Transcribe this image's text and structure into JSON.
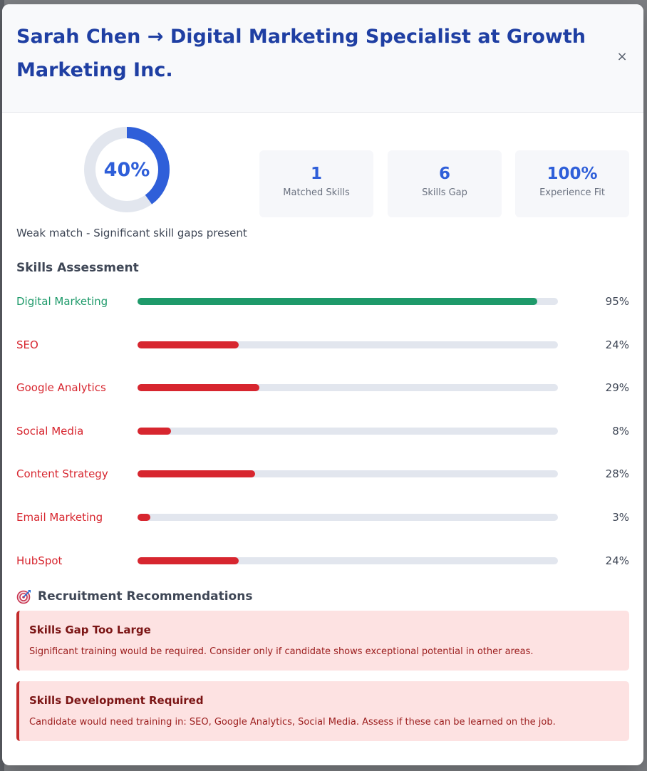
{
  "header": {
    "title": "Sarah Chen → Digital Marketing Specialist at Growth Marketing Inc.",
    "close_glyph": "×"
  },
  "summary": {
    "match_percent": 40,
    "match_label": "40%",
    "match_description": "Weak match - Significant skill gaps present",
    "stats": [
      {
        "value": "1",
        "label": "Matched Skills"
      },
      {
        "value": "6",
        "label": "Skills Gap"
      },
      {
        "value": "100%",
        "label": "Experience Fit"
      }
    ]
  },
  "colors": {
    "accent": "#2f5fd9",
    "title": "#1f3fa3",
    "match": "#1e9a6a",
    "gap": "#d7262f",
    "track": "#e2e6ee"
  },
  "skills_section": {
    "title": "Skills Assessment",
    "items": [
      {
        "name": "Digital Marketing",
        "percent": 95,
        "label": "95%",
        "status": "match"
      },
      {
        "name": "SEO",
        "percent": 24,
        "label": "24%",
        "status": "gap"
      },
      {
        "name": "Google Analytics",
        "percent": 29,
        "label": "29%",
        "status": "gap"
      },
      {
        "name": "Social Media",
        "percent": 8,
        "label": "8%",
        "status": "gap"
      },
      {
        "name": "Content Strategy",
        "percent": 28,
        "label": "28%",
        "status": "gap"
      },
      {
        "name": "Email Marketing",
        "percent": 3,
        "label": "3%",
        "status": "gap"
      },
      {
        "name": "HubSpot",
        "percent": 24,
        "label": "24%",
        "status": "gap"
      }
    ]
  },
  "recommendations": {
    "icon": "target-icon",
    "title": "Recruitment Recommendations",
    "items": [
      {
        "heading": "Skills Gap Too Large",
        "text": "Significant training would be required. Consider only if candidate shows exceptional potential in other areas."
      },
      {
        "heading": "Skills Development Required",
        "text": "Candidate would need training in: SEO, Google Analytics, Social Media. Assess if these can be learned on the job."
      }
    ]
  }
}
